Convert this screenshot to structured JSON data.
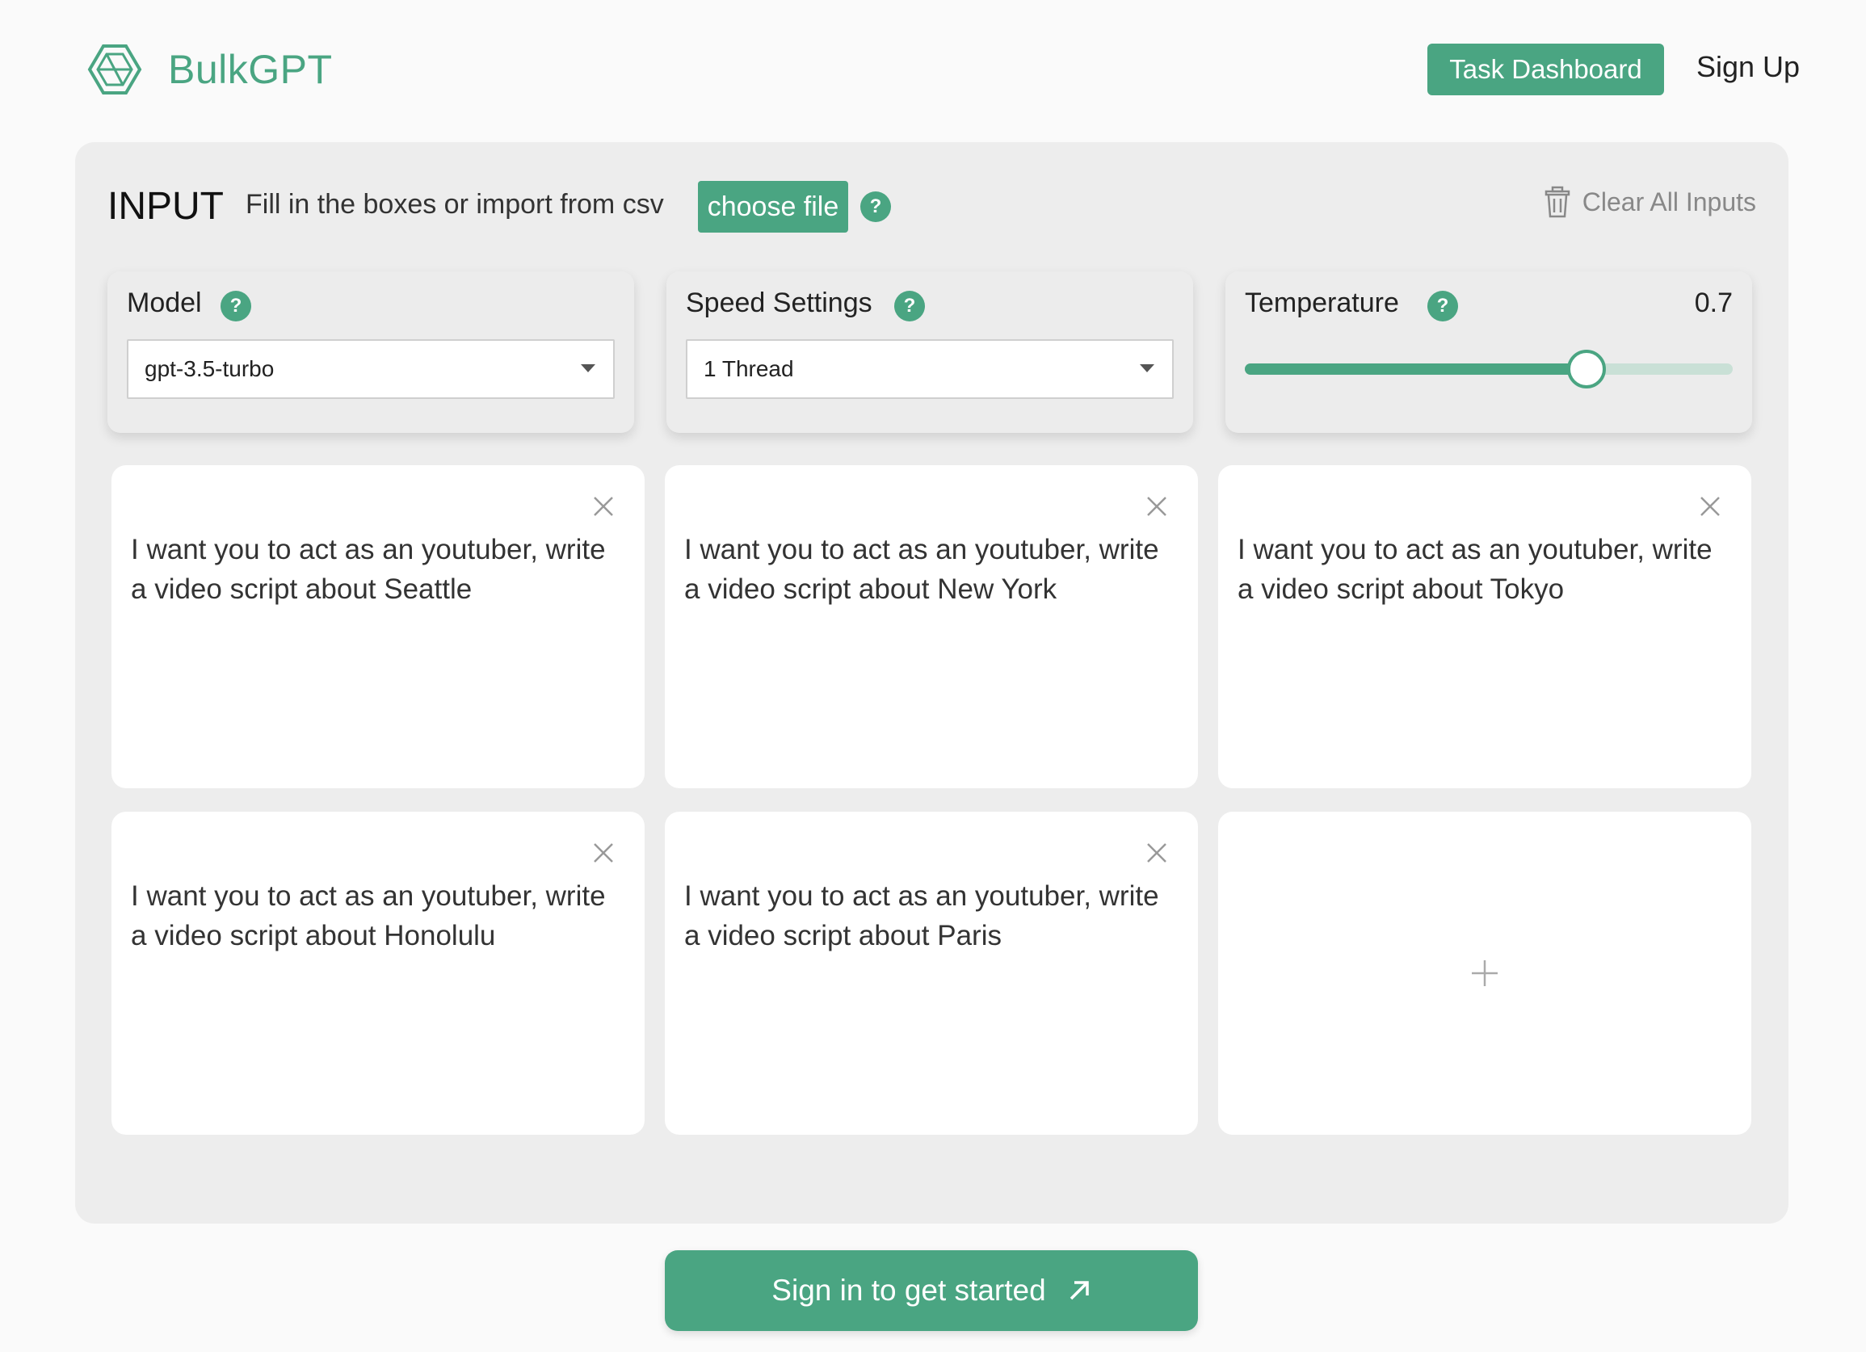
{
  "header": {
    "brand_name": "BulkGPT",
    "logo_icon": "hexagon-logo-icon",
    "task_dashboard_label": "Task Dashboard",
    "signup_label": "Sign Up"
  },
  "input_panel": {
    "title": "INPUT",
    "subtitle": "Fill in the boxes or import from csv",
    "choose_file_label": "choose file",
    "help_glyph": "?",
    "clear_all_label": "Clear All Inputs"
  },
  "settings": {
    "model": {
      "label": "Model",
      "value": "gpt-3.5-turbo"
    },
    "speed": {
      "label": "Speed Settings",
      "value": "1 Thread"
    },
    "temperature": {
      "label": "Temperature",
      "value": "0.7",
      "level": 0.7
    }
  },
  "prompts": [
    {
      "text": "I want you to act as an youtuber, write a video script about Seattle"
    },
    {
      "text": "I want you to act as an youtuber, write a video script about New York"
    },
    {
      "text": "I want you to act as an youtuber, write a video script about Tokyo"
    },
    {
      "text": "I want you to act as an youtuber, write a video script about Honolulu"
    },
    {
      "text": "I want you to act as an youtuber, write a video script about Paris"
    }
  ],
  "add_prompt_icon": "plus-icon",
  "cta": {
    "label": "Sign in to get started",
    "icon": "arrow-up-right-icon"
  },
  "colors": {
    "accent": "#4aa582",
    "panel_bg": "#ededed",
    "page_bg": "#fafafa"
  }
}
